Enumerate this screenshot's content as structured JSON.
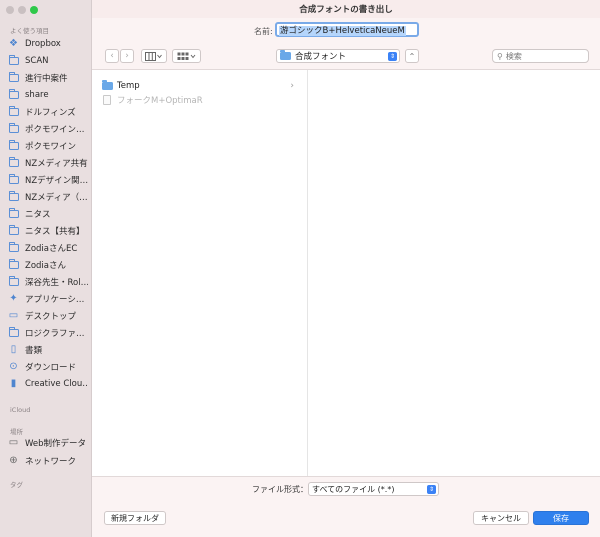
{
  "window": {
    "title": "合成フォントの書き出し"
  },
  "name_field": {
    "label": "名前:",
    "value": "游ゴシックB+HelveticaNeueM"
  },
  "toolbar": {
    "back_glyph": "‹",
    "forward_glyph": "›",
    "location": "合成フォント",
    "search_placeholder": "検索"
  },
  "sidebar": {
    "favorites_title": "よく使う項目",
    "favorites": [
      {
        "label": "Dropbox",
        "icon": "dropbox-icon"
      },
      {
        "label": "SCAN",
        "icon": "folder-icon"
      },
      {
        "label": "進行中案件",
        "icon": "folder-icon"
      },
      {
        "label": "share",
        "icon": "folder-icon"
      },
      {
        "label": "ドルフィンズ",
        "icon": "folder-icon"
      },
      {
        "label": "ポクモワイン…",
        "icon": "folder-icon"
      },
      {
        "label": "ポクモワイン",
        "icon": "folder-icon"
      },
      {
        "label": "NZメディア共有",
        "icon": "folder-icon"
      },
      {
        "label": "NZデザイン関…",
        "icon": "folder-icon"
      },
      {
        "label": "NZメディア（…",
        "icon": "folder-icon"
      },
      {
        "label": "ニタス",
        "icon": "folder-icon"
      },
      {
        "label": "ニタス【共有】",
        "icon": "folder-icon"
      },
      {
        "label": "ZodiaさんEC",
        "icon": "folder-icon"
      },
      {
        "label": "Zodiaさん",
        "icon": "folder-icon"
      },
      {
        "label": "深谷先生・Rol…",
        "icon": "folder-icon"
      },
      {
        "label": "アプリケーシ…",
        "icon": "applications-icon"
      },
      {
        "label": "デスクトップ",
        "icon": "desktop-icon"
      },
      {
        "label": "ロジクラファ…",
        "icon": "folder-icon"
      },
      {
        "label": "書類",
        "icon": "document-icon"
      },
      {
        "label": "ダウンロード",
        "icon": "download-icon"
      },
      {
        "label": "Creative Clou…",
        "icon": "creative-cloud-icon"
      }
    ],
    "icloud_title": "iCloud",
    "locations_title": "場所",
    "locations": [
      {
        "label": "Web制作データ",
        "icon": "drive-icon"
      },
      {
        "label": "ネットワーク",
        "icon": "network-icon"
      }
    ],
    "tags_title": "タグ"
  },
  "browser": {
    "items": [
      {
        "label": "Temp",
        "type": "folder",
        "enabled": true
      },
      {
        "label": "フォークM+OptimaR",
        "type": "file",
        "enabled": false
      }
    ]
  },
  "format": {
    "label": "ファイル形式：",
    "value": "すべてのファイル (*.*)"
  },
  "buttons": {
    "new_folder": "新規フォルダ",
    "cancel": "キャンセル",
    "save": "保存"
  },
  "colors": {
    "accent": "#2f80ed",
    "sidebar_bg": "#e9dfe0",
    "folder_icon": "#5b8fd6"
  }
}
